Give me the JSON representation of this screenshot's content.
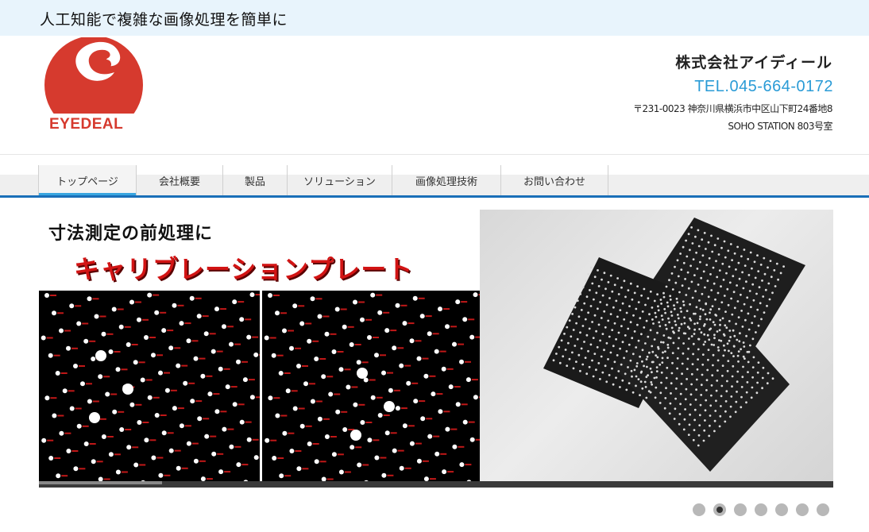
{
  "header": {
    "tagline": "人工知能で複雑な画像処理を簡単に",
    "logo_text": "EYEDEAL",
    "company_name": "株式会社アイディール",
    "tel": "TEL.045-664-0172",
    "address_line1": "〒231-0023 神奈川県横浜市中区山下町24番地8",
    "address_line2": "SOHO STATION 803号室"
  },
  "nav": {
    "items": [
      {
        "label": "トップページ",
        "active": true
      },
      {
        "label": "会社概要",
        "active": false
      },
      {
        "label": "製品",
        "active": false
      },
      {
        "label": "ソリューション",
        "active": false
      },
      {
        "label": "画像処理技術",
        "active": false
      },
      {
        "label": "お問い合わせ",
        "active": false
      }
    ]
  },
  "slider": {
    "heading": "寸法測定の前処理に",
    "title": "キャリブレーションプレート",
    "progress": 0.155,
    "slide_count": 7,
    "active_index": 1
  },
  "colors": {
    "brand_red": "#d63a2e",
    "tel_blue": "#2a9bd6",
    "nav_blue": "#1a6fb8",
    "active_tab": "#39a6e0"
  }
}
